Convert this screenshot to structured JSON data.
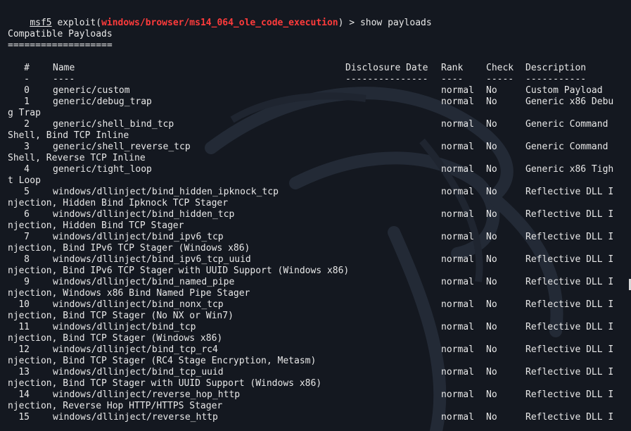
{
  "terminal": {
    "prompt": {
      "name": "msf5",
      "sep1": " exploit(",
      "module": "windows/browser/ms14_064_ole_code_execution",
      "sep2": ") > ",
      "command": "show payloads"
    },
    "heading": "Compatible Payloads",
    "heading_rule": "===================",
    "columns": [
      "#",
      "Name",
      "Disclosure Date",
      "Rank",
      "Check",
      "Description"
    ],
    "rules": [
      "-",
      "----",
      "---------------",
      "----",
      "-----",
      "-----------"
    ],
    "rows": [
      {
        "num": "0",
        "name": "generic/custom",
        "rank": "normal",
        "check": "No",
        "desc": "Custom Payload"
      },
      {
        "num": "1",
        "name": "generic/debug_trap",
        "rank": "normal",
        "check": "No",
        "desc": "Generic x86 Debu",
        "cont": "g Trap"
      },
      {
        "num": "2",
        "name": "generic/shell_bind_tcp",
        "rank": "normal",
        "check": "No",
        "desc": "Generic Command",
        "cont": "Shell, Bind TCP Inline"
      },
      {
        "num": "3",
        "name": "generic/shell_reverse_tcp",
        "rank": "normal",
        "check": "No",
        "desc": "Generic Command",
        "cont": "Shell, Reverse TCP Inline"
      },
      {
        "num": "4",
        "name": "generic/tight_loop",
        "rank": "normal",
        "check": "No",
        "desc": "Generic x86 Tigh",
        "cont": "t Loop"
      },
      {
        "num": "5",
        "name": "windows/dllinject/bind_hidden_ipknock_tcp",
        "rank": "normal",
        "check": "No",
        "desc": "Reflective DLL I",
        "cont": "njection, Hidden Bind Ipknock TCP Stager"
      },
      {
        "num": "6",
        "name": "windows/dllinject/bind_hidden_tcp",
        "rank": "normal",
        "check": "No",
        "desc": "Reflective DLL I",
        "cont": "njection, Hidden Bind TCP Stager"
      },
      {
        "num": "7",
        "name": "windows/dllinject/bind_ipv6_tcp",
        "rank": "normal",
        "check": "No",
        "desc": "Reflective DLL I",
        "cont": "njection, Bind IPv6 TCP Stager (Windows x86)"
      },
      {
        "num": "8",
        "name": "windows/dllinject/bind_ipv6_tcp_uuid",
        "rank": "normal",
        "check": "No",
        "desc": "Reflective DLL I",
        "cont": "njection, Bind IPv6 TCP Stager with UUID Support (Windows x86)"
      },
      {
        "num": "9",
        "name": "windows/dllinject/bind_named_pipe",
        "rank": "normal",
        "check": "No",
        "desc": "Reflective DLL I",
        "cont": "njection, Windows x86 Bind Named Pipe Stager"
      },
      {
        "num": "10",
        "name": "windows/dllinject/bind_nonx_tcp",
        "rank": "normal",
        "check": "No",
        "desc": "Reflective DLL I",
        "cont": "njection, Bind TCP Stager (No NX or Win7)"
      },
      {
        "num": "11",
        "name": "windows/dllinject/bind_tcp",
        "rank": "normal",
        "check": "No",
        "desc": "Reflective DLL I",
        "cont": "njection, Bind TCP Stager (Windows x86)"
      },
      {
        "num": "12",
        "name": "windows/dllinject/bind_tcp_rc4",
        "rank": "normal",
        "check": "No",
        "desc": "Reflective DLL I",
        "cont": "njection, Bind TCP Stager (RC4 Stage Encryption, Metasm)"
      },
      {
        "num": "13",
        "name": "windows/dllinject/bind_tcp_uuid",
        "rank": "normal",
        "check": "No",
        "desc": "Reflective DLL I",
        "cont": "njection, Bind TCP Stager with UUID Support (Windows x86)"
      },
      {
        "num": "14",
        "name": "windows/dllinject/reverse_hop_http",
        "rank": "normal",
        "check": "No",
        "desc": "Reflective DLL I",
        "cont": "njection, Reverse Hop HTTP/HTTPS Stager"
      },
      {
        "num": "15",
        "name": "windows/dllinject/reverse_http",
        "rank": "normal",
        "check": "No",
        "desc": "Reflective DLL I"
      }
    ]
  }
}
